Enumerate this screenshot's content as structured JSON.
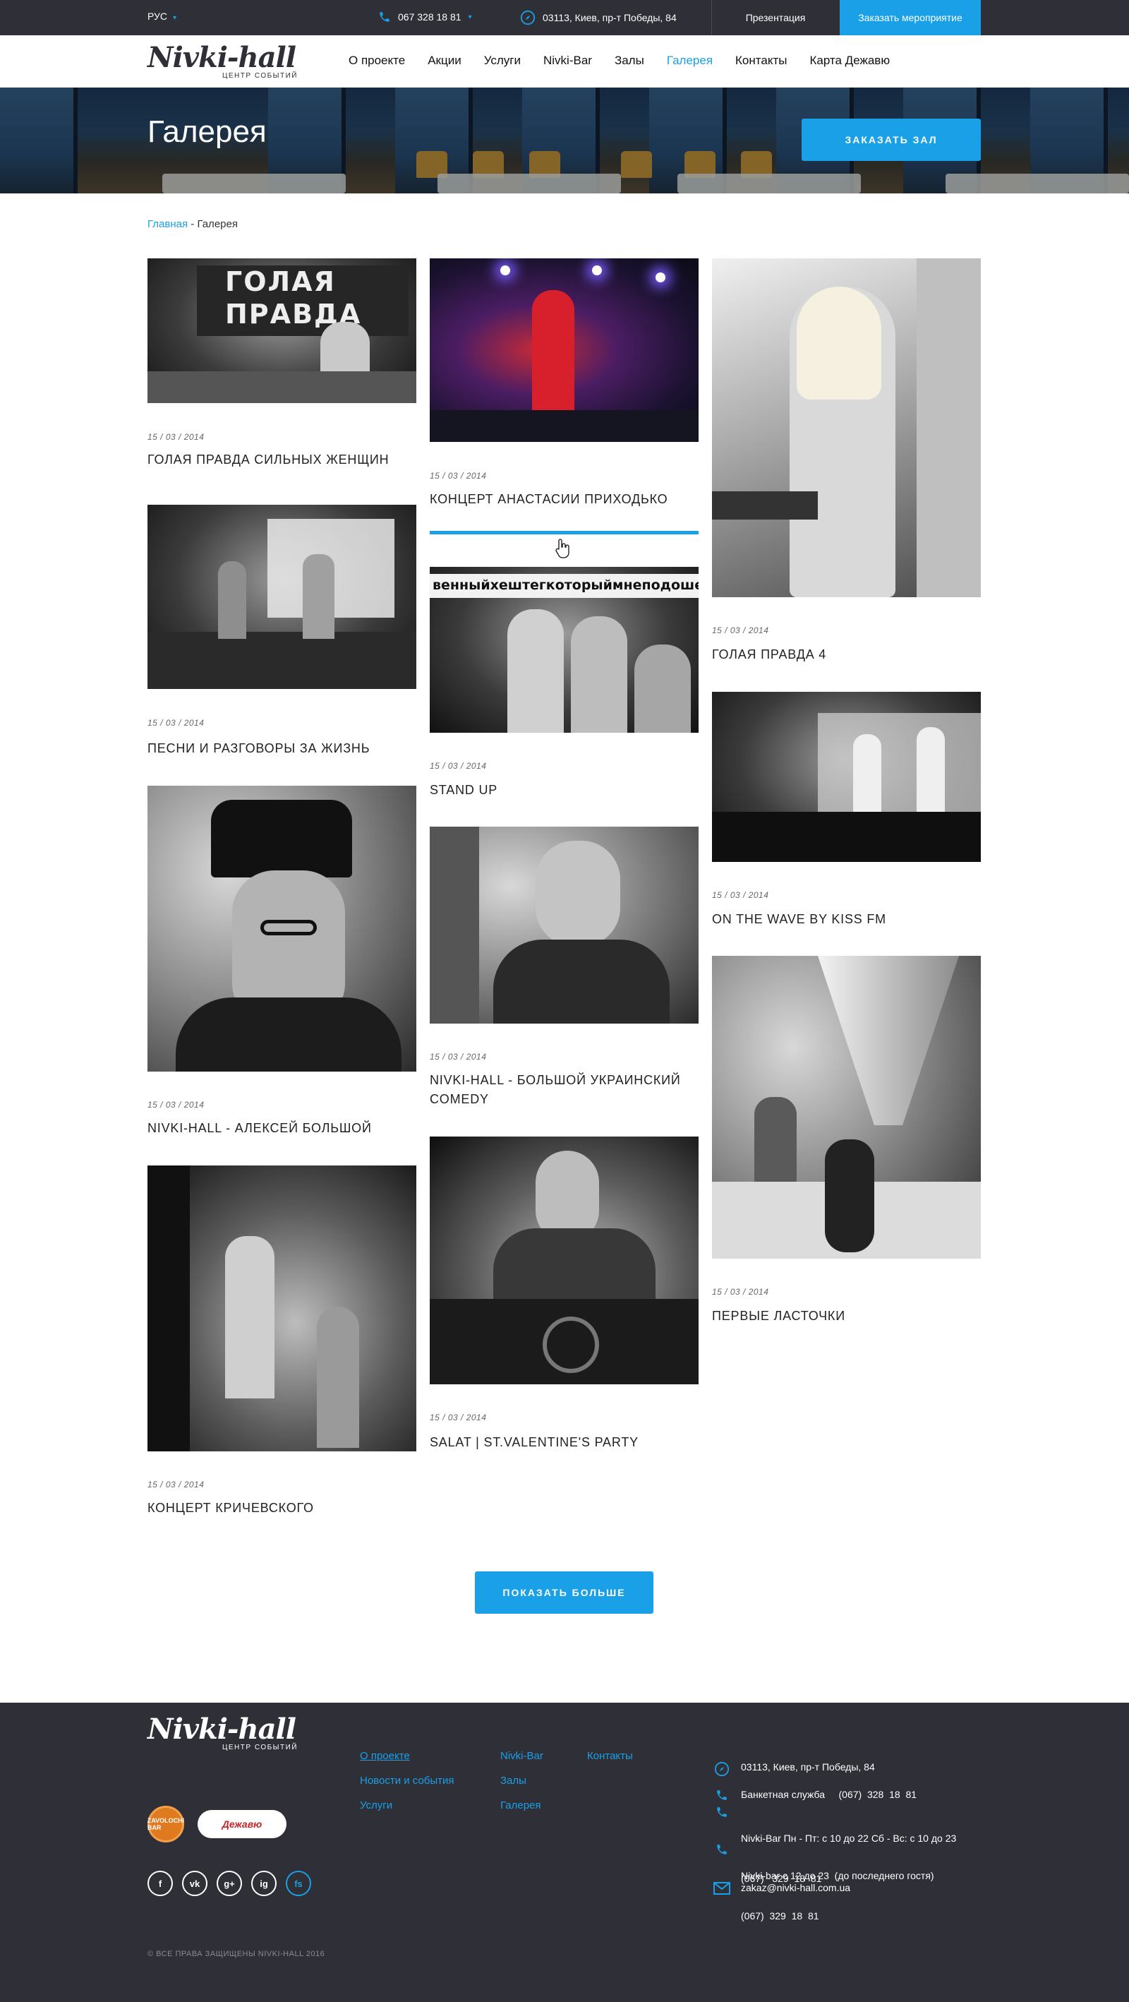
{
  "topbar": {
    "lang": "РУС",
    "phone": "067 328 18 81",
    "address": "03113, Киев, пр-т Победы, 84",
    "presentation": "Презентация",
    "order_event": "Заказать мероприятие"
  },
  "logo": {
    "name": "Nivki-hall",
    "tagline": "ЦЕНТР СОБЫТИЙ"
  },
  "nav": [
    "О проекте",
    "Акции",
    "Услуги",
    "Nivki-Bar",
    "Залы",
    "Галерея",
    "Контакты",
    "Карта Дежавю"
  ],
  "nav_active": "Галерея",
  "hero": {
    "title": "Галерея",
    "button": "ЗАКАЗАТЬ ЗАЛ"
  },
  "breadcrumb": {
    "home": "Главная",
    "separator": " - ",
    "current": "Галерея"
  },
  "gallery": [
    {
      "date": "15 / 03 / 2014",
      "title": "ГОЛАЯ ПРАВДА СИЛЬНЫХ ЖЕНЩИН",
      "image_text": "ГОЛАЯ ПРАВДА"
    },
    {
      "date": "15 / 03 / 2014",
      "title": "КОНЦЕРТ АНАСТАСИИ ПРИХОДЬКО"
    },
    {
      "date": "15 / 03 / 2014",
      "title": "ГОЛАЯ ПРАВДА 4"
    },
    {
      "date": "15 / 03 / 2014",
      "title": "ПЕСНИ И РАЗГОВОРЫ ЗА ЖИЗНЬ"
    },
    {
      "date": "15 / 03 / 2014",
      "title": "STAND UP",
      "image_text": "венныйхештегкоторыймнеподоше"
    },
    {
      "date": "15 / 03 / 2014",
      "title": "ON THE WAVE BY KISS FM"
    },
    {
      "date": "15 / 03 / 2014",
      "title": "NIVKI-HALL - АЛЕКСЕЙ БОЛЬШОЙ"
    },
    {
      "date": "15 / 03 / 2014",
      "title": "NIVKI-HALL - БОЛЬШОЙ УКРАИНСКИЙ COMEDY"
    },
    {
      "date": "15 / 03 / 2014",
      "title": "ПЕРВЫЕ ЛАСТОЧКИ"
    },
    {
      "date": "15 / 03 / 2014",
      "title": "КОНЦЕРТ КРИЧЕВСКОГО"
    },
    {
      "date": "15 / 03 / 2014",
      "title": "SALAT | ST.VALENTINE'S PARTY"
    }
  ],
  "show_more": "ПОКАЗАТЬ БОЛЬШЕ",
  "footer": {
    "col1": [
      "О проекте",
      "Новости и события",
      "Услуги"
    ],
    "col2": [
      "Nivki-Bar",
      "Залы",
      "Галерея"
    ],
    "col3": [
      "Контакты"
    ],
    "partners": [
      "ZAVOLOCHI BAR",
      "Дежавю"
    ],
    "socials": [
      "f",
      "vk",
      "g+",
      "ig",
      "fs"
    ],
    "contacts": {
      "address": "03113, Киев, пр-т Победы, 84",
      "banquet": "Банкетная служба     (067)  328  18  81",
      "bar_hours": "Nivki-Bar Пн - Пт: с 10 до 22 Сб - Вс: с 10 до 23",
      "bar_phone": "(067)   329  18  81",
      "bar2_hours": "Nivki-bar с 12 до 23  (до последнего гостя)",
      "bar2_phone": "(067)  329  18  81",
      "email": "zakaz@nivki-hall.com.ua"
    },
    "copyright": "© ВСЕ ПРАВА ЗАЩИЩЕНЫ NIVKI-HALL 2016"
  },
  "colors": {
    "accent": "#1aa0e6",
    "dark": "#2e2f37"
  }
}
